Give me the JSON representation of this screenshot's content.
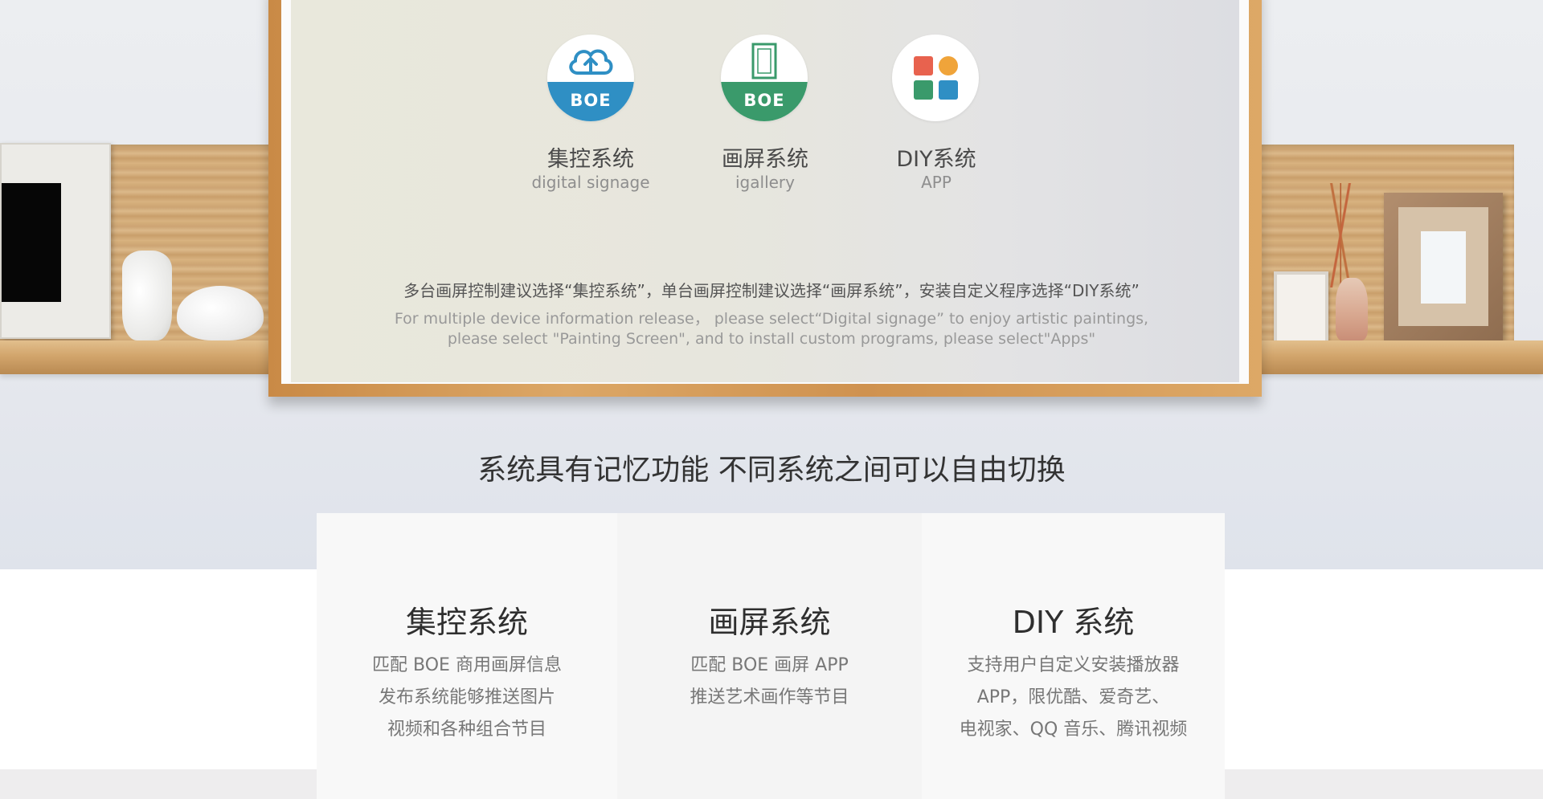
{
  "banner": {
    "systems": [
      {
        "title": "集控系统",
        "subtitle": "digital signage",
        "brand": "BOE",
        "icon": "cloud-upload-icon",
        "color": "#2f8fc4"
      },
      {
        "title": "画屏系统",
        "subtitle": "igallery",
        "brand": "BOE",
        "icon": "frame-icon",
        "color": "#3a9a6b"
      },
      {
        "title": "DIY系统",
        "subtitle": "APP",
        "icon": "app-grid-icon",
        "colors": [
          "#e8624e",
          "#f0a43a",
          "#3a9a6b",
          "#2f8fc4"
        ]
      }
    ],
    "note_zh": "多台画屏控制建议选择“集控系统”，单台画屏控制建议选择“画屏系统”，安装自定义程序选择“DIY系统”",
    "note_en_line1": "For multiple device information release， please select“Digital signage” to enjoy artistic paintings,",
    "note_en_line2": "please select \"Painting Screen\", and to install custom programs, please select\"Apps\""
  },
  "headline": "系统具有记忆功能 不同系统之间可以自由切换",
  "cards": [
    {
      "title": "集控系统",
      "lines": [
        "匹配 BOE 商用画屏信息",
        "发布系统能够推送图片",
        "视频和各种组合节目"
      ]
    },
    {
      "title": "画屏系统",
      "lines": [
        "匹配 BOE 画屏 APP",
        "推送艺术画作等节目"
      ]
    },
    {
      "title": "DIY 系统",
      "lines": [
        "支持用户自定义安装播放器",
        "APP，限优酷、爱奇艺、",
        "电视家、QQ 音乐、腾讯视频"
      ]
    }
  ]
}
